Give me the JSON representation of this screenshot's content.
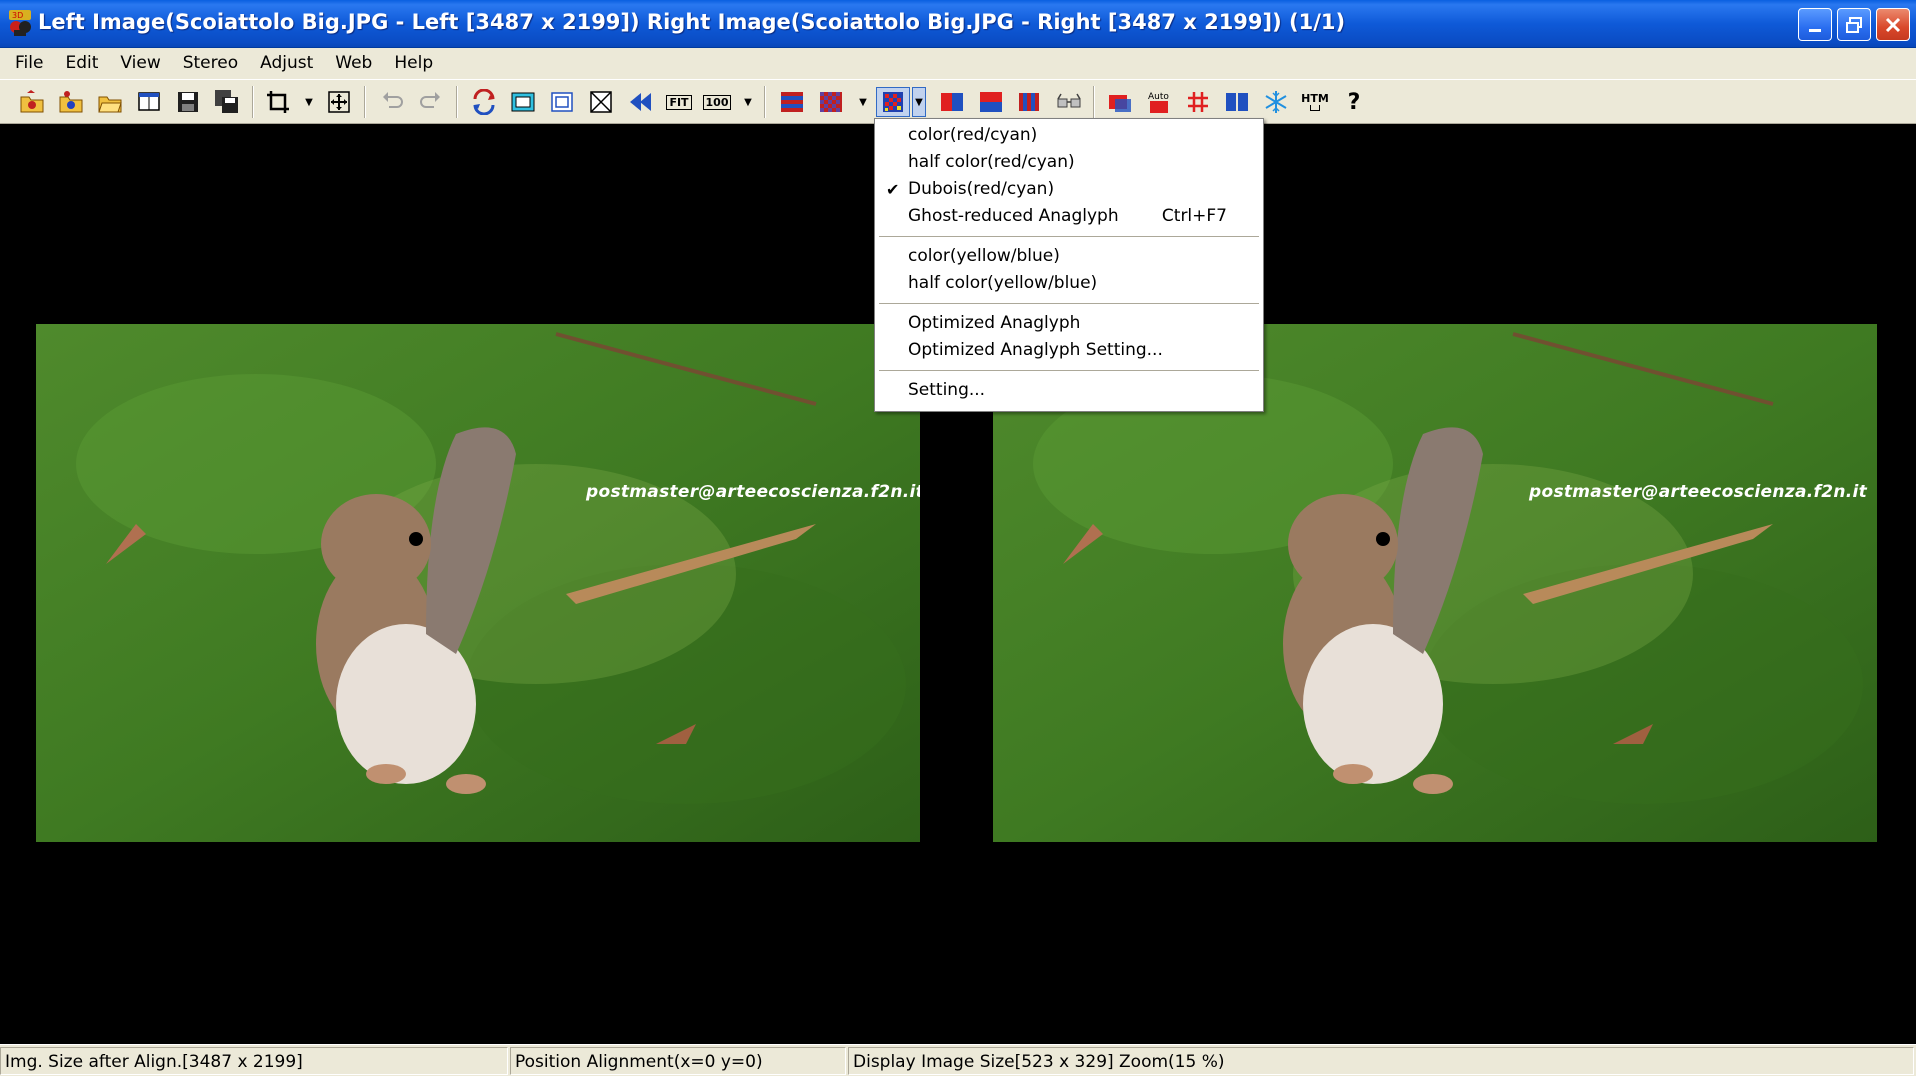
{
  "window": {
    "title": "Left Image(Scoiattolo Big.JPG - Left [3487 x 2199]) Right Image(Scoiattolo Big.JPG - Right [3487 x 2199])  (1/1)",
    "minimize_icon": "minimize-icon",
    "restore_icon": "restore-icon",
    "close_icon": "close-icon"
  },
  "menubar": {
    "items": [
      "File",
      "Edit",
      "View",
      "Stereo",
      "Adjust",
      "Web",
      "Help"
    ]
  },
  "toolbar": {
    "fit_label": "FIT",
    "zoom100_label": "100",
    "auto_label": "Auto",
    "html_label": "HTM",
    "help_label": "?",
    "icons": [
      "open-left-icon",
      "open-right-icon",
      "open-folder-icon",
      "open-stereo-icon",
      "save-icon",
      "save-all-icon",
      "crop-icon",
      "align-icon",
      "undo-icon",
      "redo-icon",
      "swap-icon",
      "window-icon",
      "frame-icon",
      "fullscreen-icon",
      "prev-icon",
      "fit-icon",
      "zoom-100-icon",
      "interlaced-icon",
      "checkerboard-icon",
      "anaglyph-icon",
      "side-by-side-icon",
      "above-below-icon",
      "vertical-stripe-icon",
      "glasses-icon",
      "red-screen-icon",
      "auto-align-icon",
      "grid-icon",
      "parallel-icon",
      "snowflake-icon",
      "html-icon",
      "help-icon"
    ]
  },
  "dropdown": {
    "group1": [
      {
        "label": "color(red/cyan)",
        "checked": false,
        "shortcut": ""
      },
      {
        "label": "half color(red/cyan)",
        "checked": false,
        "shortcut": ""
      },
      {
        "label": "Dubois(red/cyan)",
        "checked": true,
        "shortcut": ""
      },
      {
        "label": "Ghost-reduced Anaglyph",
        "checked": false,
        "shortcut": "Ctrl+F7"
      }
    ],
    "group2": [
      {
        "label": "color(yellow/blue)"
      },
      {
        "label": "half color(yellow/blue)"
      }
    ],
    "group3": [
      {
        "label": "Optimized Anaglyph"
      },
      {
        "label": "Optimized Anaglyph Setting..."
      }
    ],
    "group4": [
      {
        "label": "Setting..."
      }
    ],
    "check_mark": "✔"
  },
  "images": {
    "left_watermark": "postmaster@arteecoscienza.f2n.it",
    "right_watermark": "postmaster@arteecoscienza.f2n.it"
  },
  "statusbar": {
    "size_after_align": "Img. Size after Align.[3487 x 2199]",
    "position_alignment": "Position Alignment(x=0 y=0)",
    "display_size": "Display Image Size[523 x 329]  Zoom(15 %)"
  }
}
